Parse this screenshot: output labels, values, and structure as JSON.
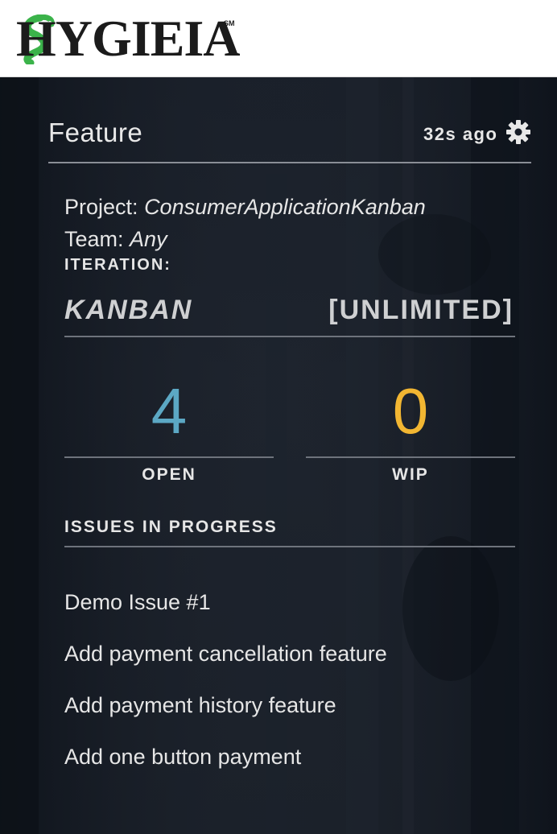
{
  "header": {
    "logo_text": "HYGIEIA",
    "logo_mark": "SM"
  },
  "widget": {
    "title": "Feature",
    "updated": "32s ago",
    "settings_icon": "gear-icon",
    "project_label": "Project:",
    "project_value": "ConsumerApplicationKanban",
    "team_label": "Team:",
    "team_value": "Any",
    "iteration_label": "ITERATION:",
    "iteration_name": "KANBAN",
    "iteration_limit": "[UNLIMITED]",
    "stats": [
      {
        "value": "4",
        "label": "OPEN",
        "color": "#5ca8c4"
      },
      {
        "value": "0",
        "label": "WIP",
        "color": "#f2b632"
      }
    ],
    "issues_heading": "ISSUES IN PROGRESS",
    "issues": [
      "Demo Issue #1",
      "Add payment cancellation feature",
      "Add payment history feature",
      "Add one button payment"
    ]
  },
  "colors": {
    "logo_green": "#3bb34a",
    "logo_dark": "#1b1b1b",
    "background": "#151b25"
  }
}
